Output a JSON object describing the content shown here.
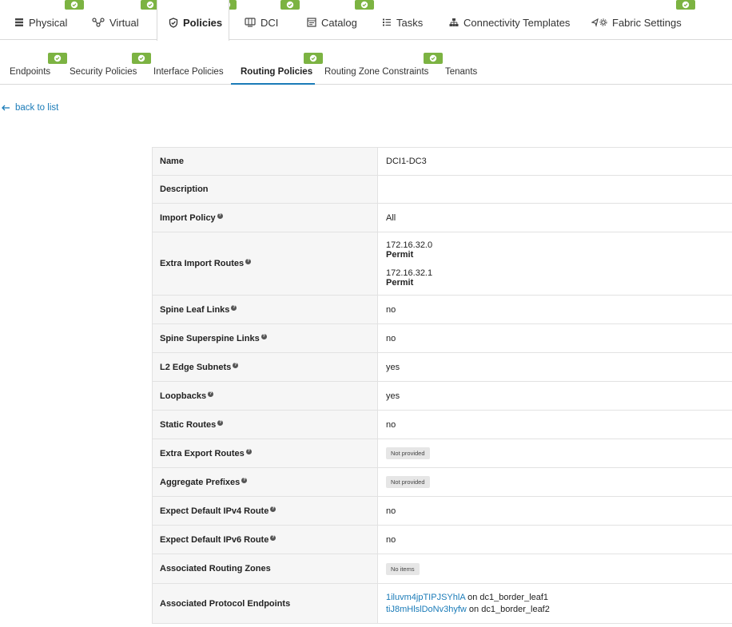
{
  "top_nav": {
    "tabs": [
      {
        "label": "Physical",
        "icon": "server-icon",
        "active": false
      },
      {
        "label": "Virtual",
        "icon": "network-nodes-icon",
        "active": false
      },
      {
        "label": "Policies",
        "icon": "shield-icon",
        "active": true
      },
      {
        "label": "DCI",
        "icon": "globe-icon",
        "active": false
      },
      {
        "label": "Catalog",
        "icon": "catalog-icon",
        "active": false
      },
      {
        "label": "Tasks",
        "icon": "task-list-icon",
        "active": false
      },
      {
        "label": "Connectivity Templates",
        "icon": "hierarchy-icon",
        "active": false
      },
      {
        "label": "Fabric Settings",
        "icon": "settings-icon",
        "active": false
      }
    ]
  },
  "sub_nav": {
    "tabs": [
      {
        "label": "Endpoints",
        "active": false
      },
      {
        "label": "Security Policies",
        "active": false
      },
      {
        "label": "Interface Policies",
        "active": false
      },
      {
        "label": "Routing Policies",
        "active": true
      },
      {
        "label": "Routing Zone Constraints",
        "active": false
      },
      {
        "label": "Tenants",
        "active": false
      }
    ]
  },
  "back_link": "back to list",
  "details": {
    "name_label": "Name",
    "name_value": "DCI1-DC3",
    "description_label": "Description",
    "description_value": "",
    "import_policy_label": "Import Policy",
    "import_policy_value": "All",
    "extra_import_routes_label": "Extra Import Routes",
    "extra_import_routes": [
      {
        "prefix": "172.16.32.0",
        "action": "Permit"
      },
      {
        "prefix": "172.16.32.1",
        "action": "Permit"
      }
    ],
    "spine_leaf_links_label": "Spine Leaf Links",
    "spine_leaf_links_value": "no",
    "spine_superspine_links_label": "Spine Superspine Links",
    "spine_superspine_links_value": "no",
    "l2_edge_subnets_label": "L2 Edge Subnets",
    "l2_edge_subnets_value": "yes",
    "loopbacks_label": "Loopbacks",
    "loopbacks_value": "yes",
    "static_routes_label": "Static Routes",
    "static_routes_value": "no",
    "extra_export_routes_label": "Extra Export Routes",
    "extra_export_routes_value": "Not provided",
    "aggregate_prefixes_label": "Aggregate Prefixes",
    "aggregate_prefixes_value": "Not provided",
    "expect_ipv4_label": "Expect Default IPv4 Route",
    "expect_ipv4_value": "no",
    "expect_ipv6_label": "Expect Default IPv6 Route",
    "expect_ipv6_value": "no",
    "associated_zones_label": "Associated Routing Zones",
    "associated_zones_value": "No items",
    "associated_endpoints_label": "Associated Protocol Endpoints",
    "associated_endpoints": [
      {
        "id": "1iluvm4jpTIPJSYhlA",
        "on": "on",
        "device": "dc1_border_leaf1"
      },
      {
        "id": "tiJ8mHlslDoNv3hyfw",
        "on": "on",
        "device": "dc1_border_leaf2"
      }
    ]
  },
  "colors": {
    "accent": "#1a7bb8",
    "badge_green": "#7cb342",
    "label_bg": "#f6f6f6",
    "pill_bg": "#e6e6e6"
  }
}
